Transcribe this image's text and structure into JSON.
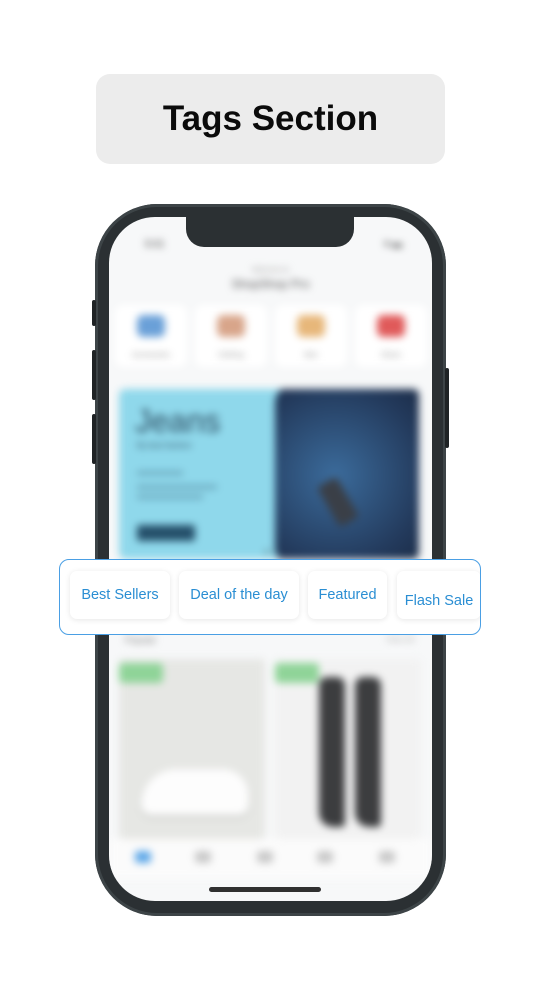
{
  "header": {
    "title": "Tags Section"
  },
  "phone": {
    "status_time": "9:41",
    "status_icons": "▾ ▬",
    "store_subtitle": "Welcome to",
    "store_title": "ShopShop Pro",
    "categories": [
      {
        "label": "Accessories",
        "icon": "glasses-icon",
        "color": "#6aa0d8"
      },
      {
        "label": "Clothing",
        "icon": "hanger-icon",
        "color": "#d8a58a"
      },
      {
        "label": "Men",
        "icon": "man-icon",
        "color": "#e7b77a"
      },
      {
        "label": "Shoes",
        "icon": "shoe-icon",
        "color": "#e05a5a"
      }
    ],
    "banner": {
      "title": "Jeans",
      "subtitle": "By best fashion",
      "cta": "SHOP"
    },
    "section": {
      "title": "Popular",
      "more": "View All"
    }
  },
  "tags": {
    "items": [
      {
        "label": "Best Sellers"
      },
      {
        "label": "Deal of the day"
      },
      {
        "label": "Featured"
      },
      {
        "label": "Flash Sale"
      }
    ],
    "accent_color": "#2a8ed3",
    "border_color": "#4a9fe4"
  }
}
